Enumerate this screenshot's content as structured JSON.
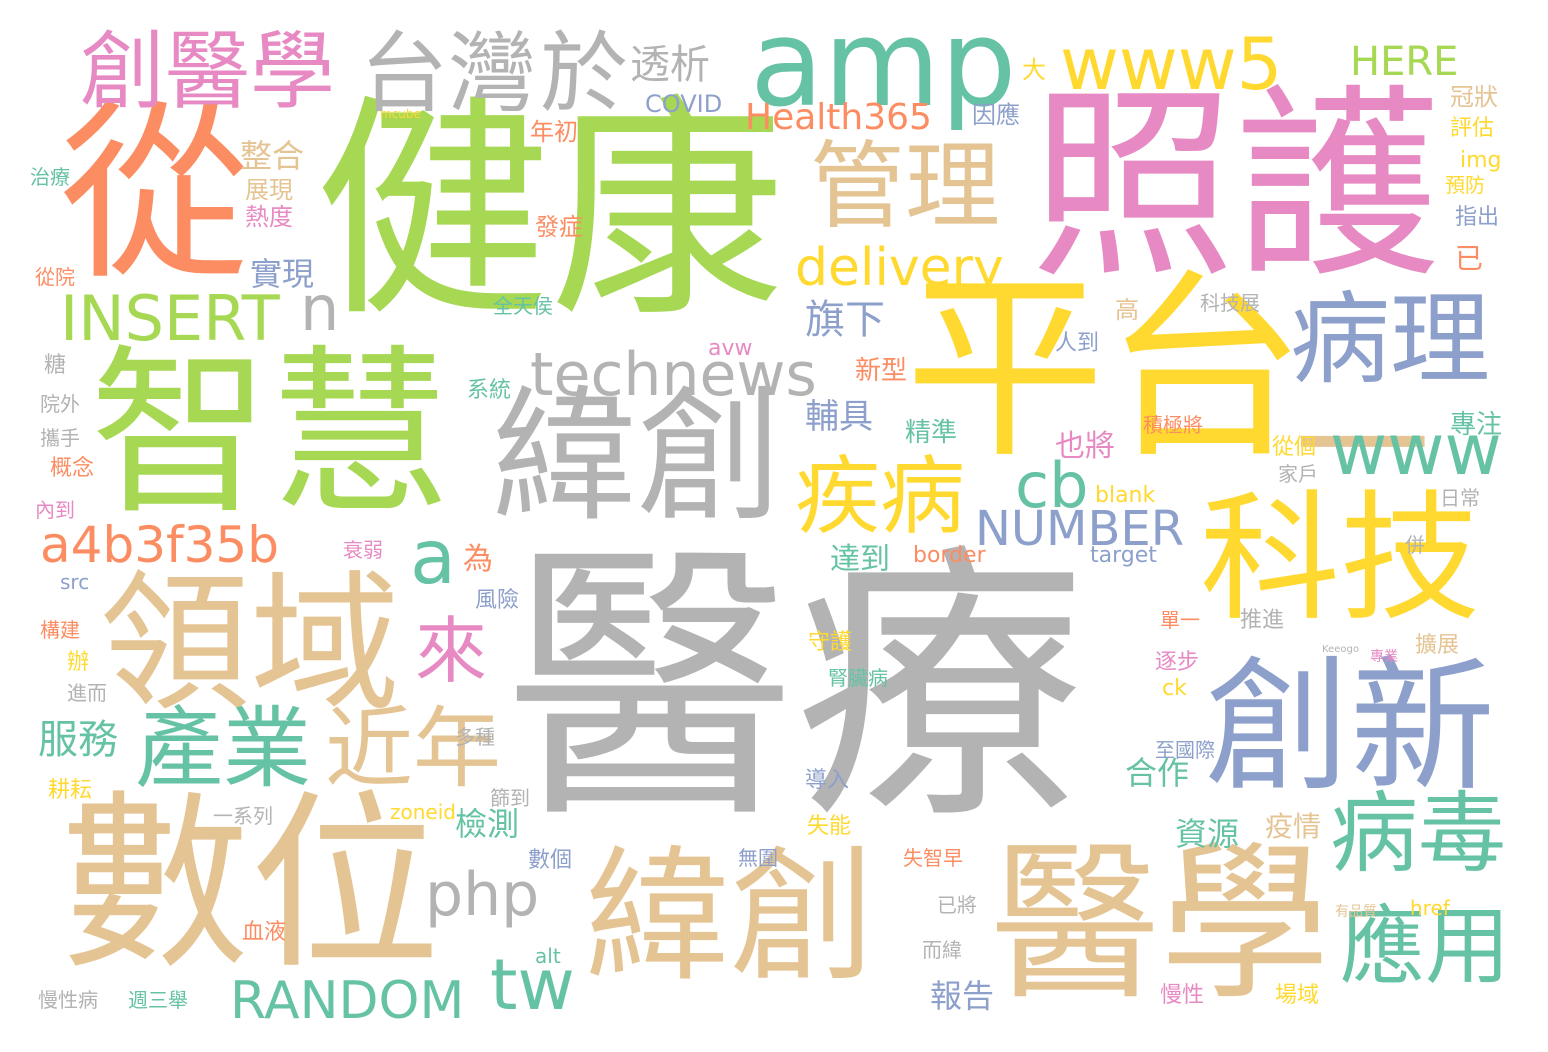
{
  "palette": {
    "gray": "#b3b3b3",
    "green": "#a6d854",
    "orange": "#fc8d62",
    "pink": "#e78ac3",
    "yellow": "#ffd92f",
    "tan": "#e5c494",
    "blue": "#8da0cb",
    "teal": "#66c2a5"
  },
  "words": [
    {
      "text": "醫療",
      "color": "gray",
      "vertical": false
    },
    {
      "text": "健康",
      "color": "green",
      "vertical": false
    },
    {
      "text": "照護",
      "color": "pink",
      "vertical": false
    },
    {
      "text": "平台",
      "color": "yellow",
      "vertical": false
    },
    {
      "text": "從",
      "color": "orange",
      "vertical": false
    },
    {
      "text": "智慧",
      "color": "green",
      "vertical": false
    },
    {
      "text": "數位",
      "color": "tan",
      "vertical": false
    },
    {
      "text": "緯創",
      "color": "gray",
      "vertical": false
    },
    {
      "text": "緯創",
      "color": "tan",
      "vertical": false
    },
    {
      "text": "醫學",
      "color": "tan",
      "vertical": false
    },
    {
      "text": "領域",
      "color": "tan",
      "vertical": false
    },
    {
      "text": "科技",
      "color": "yellow",
      "vertical": false
    },
    {
      "text": "創新",
      "color": "blue",
      "vertical": false
    },
    {
      "text": "一",
      "color": "tan",
      "vertical": false
    },
    {
      "text": "amp",
      "color": "teal",
      "vertical": false
    },
    {
      "text": "創醫學",
      "color": "pink",
      "vertical": false
    },
    {
      "text": "台灣",
      "color": "gray",
      "vertical": false
    },
    {
      "text": "於",
      "color": "gray",
      "vertical": false
    },
    {
      "text": "管理",
      "color": "tan",
      "vertical": false
    },
    {
      "text": "病理",
      "color": "blue",
      "vertical": false
    },
    {
      "text": "病毒",
      "color": "teal",
      "vertical": false
    },
    {
      "text": "疾病",
      "color": "yellow",
      "vertical": false
    },
    {
      "text": "產業",
      "color": "teal",
      "vertical": false
    },
    {
      "text": "近年",
      "color": "tan",
      "vertical": false
    },
    {
      "text": "應用",
      "color": "teal",
      "vertical": false
    },
    {
      "text": "www5",
      "color": "yellow",
      "vertical": false
    },
    {
      "text": "www",
      "color": "teal",
      "vertical": false
    },
    {
      "text": "technews",
      "color": "gray",
      "vertical": false
    },
    {
      "text": "delivery",
      "color": "yellow",
      "vertical": false
    },
    {
      "text": "INSERT",
      "color": "green",
      "vertical": false
    },
    {
      "text": "a4b3f35b",
      "color": "orange",
      "vertical": false
    },
    {
      "text": "php",
      "color": "gray",
      "vertical": false
    },
    {
      "text": "RANDOM",
      "color": "teal",
      "vertical": false
    },
    {
      "text": "NUMBER",
      "color": "blue",
      "vertical": false
    },
    {
      "text": "tw",
      "color": "teal",
      "vertical": false
    },
    {
      "text": "cb",
      "color": "teal",
      "vertical": false
    },
    {
      "text": "a",
      "color": "teal",
      "vertical": false
    },
    {
      "text": "n",
      "color": "gray",
      "vertical": false
    },
    {
      "text": "來",
      "color": "pink",
      "vertical": false
    },
    {
      "text": "Health365",
      "color": "orange",
      "vertical": false
    },
    {
      "text": "HERE",
      "color": "green",
      "vertical": false
    },
    {
      "text": "透析",
      "color": "gray",
      "vertical": false
    },
    {
      "text": "COVID",
      "color": "blue",
      "vertical": false
    },
    {
      "text": "整合",
      "color": "tan",
      "vertical": false
    },
    {
      "text": "實現",
      "color": "blue",
      "vertical": false
    },
    {
      "text": "旗下",
      "color": "blue",
      "vertical": false
    },
    {
      "text": "服務",
      "color": "teal",
      "vertical": false
    },
    {
      "text": "年初",
      "color": "orange",
      "vertical": false
    },
    {
      "text": "展現",
      "color": "tan",
      "vertical": false
    },
    {
      "text": "熱度",
      "color": "pink",
      "vertical": false
    },
    {
      "text": "發症",
      "color": "orange",
      "vertical": false
    },
    {
      "text": "新型",
      "color": "orange",
      "vertical": false
    },
    {
      "text": "輔具",
      "color": "blue",
      "vertical": false
    },
    {
      "text": "精準",
      "color": "teal",
      "vertical": false
    },
    {
      "text": "也將",
      "color": "pink",
      "vertical": false
    },
    {
      "text": "達到",
      "color": "teal",
      "vertical": false
    },
    {
      "text": "檢測",
      "color": "teal",
      "vertical": false
    },
    {
      "text": "資源",
      "color": "teal",
      "vertical": false
    },
    {
      "text": "合作",
      "color": "teal",
      "vertical": false
    },
    {
      "text": "報告",
      "color": "blue",
      "vertical": false
    },
    {
      "text": "疫情",
      "color": "tan",
      "vertical": false
    },
    {
      "text": "冠狀",
      "color": "tan",
      "vertical": false
    },
    {
      "text": "評估",
      "color": "yellow",
      "vertical": false
    },
    {
      "text": "預防",
      "color": "yellow",
      "vertical": false
    },
    {
      "text": "指出",
      "color": "blue",
      "vertical": false
    },
    {
      "text": "專注",
      "color": "teal",
      "vertical": false
    },
    {
      "text": "日常",
      "color": "gray",
      "vertical": false
    },
    {
      "text": "因應",
      "color": "blue",
      "vertical": false
    },
    {
      "text": "大",
      "color": "yellow",
      "vertical": false
    },
    {
      "text": "高",
      "color": "tan",
      "vertical": false
    },
    {
      "text": "已",
      "color": "orange",
      "vertical": false
    },
    {
      "text": "img",
      "color": "yellow",
      "vertical": false
    },
    {
      "text": "科技展",
      "color": "gray",
      "vertical": false
    },
    {
      "text": "人到",
      "color": "blue",
      "vertical": false
    },
    {
      "text": "全天侯",
      "color": "teal",
      "vertical": false
    },
    {
      "text": "系統",
      "color": "teal",
      "vertical": false
    },
    {
      "text": "avw",
      "color": "pink",
      "vertical": false
    },
    {
      "text": "積極將",
      "color": "orange",
      "vertical": false
    },
    {
      "text": "從個",
      "color": "yellow",
      "vertical": false
    },
    {
      "text": "家戶",
      "color": "gray",
      "vertical": false
    },
    {
      "text": "blank",
      "color": "yellow",
      "vertical": false
    },
    {
      "text": "target",
      "color": "blue",
      "vertical": false
    },
    {
      "text": "border",
      "color": "orange",
      "vertical": false
    },
    {
      "text": "為",
      "color": "orange",
      "vertical": false
    },
    {
      "text": "風險",
      "color": "blue",
      "vertical": false
    },
    {
      "text": "推進",
      "color": "gray",
      "vertical": false
    },
    {
      "text": "單一",
      "color": "orange",
      "vertical": false
    },
    {
      "text": "逐步",
      "color": "pink",
      "vertical": false
    },
    {
      "text": "擴展",
      "color": "tan",
      "vertical": false
    },
    {
      "text": "ck",
      "color": "yellow",
      "vertical": false
    },
    {
      "text": "守護",
      "color": "yellow",
      "vertical": false
    },
    {
      "text": "腎臟病",
      "color": "teal",
      "vertical": false
    },
    {
      "text": "至國際",
      "color": "blue",
      "vertical": false
    },
    {
      "text": "導入",
      "color": "blue",
      "vertical": false
    },
    {
      "text": "篩到",
      "color": "gray",
      "vertical": false
    },
    {
      "text": "失能",
      "color": "yellow",
      "vertical": false
    },
    {
      "text": "數個",
      "color": "blue",
      "vertical": false
    },
    {
      "text": "失智早",
      "color": "orange",
      "vertical": false
    },
    {
      "text": "無圍",
      "color": "blue",
      "vertical": false
    },
    {
      "text": "已將",
      "color": "gray",
      "vertical": false
    },
    {
      "text": "而緯",
      "color": "gray",
      "vertical": false
    },
    {
      "text": "血液",
      "color": "orange",
      "vertical": false
    },
    {
      "text": "zoneid",
      "color": "yellow",
      "vertical": false
    },
    {
      "text": "alt",
      "color": "teal",
      "vertical": false
    },
    {
      "text": "href",
      "color": "yellow",
      "vertical": false
    },
    {
      "text": "有品質",
      "color": "tan",
      "vertical": false
    },
    {
      "text": "慢性",
      "color": "pink",
      "vertical": false
    },
    {
      "text": "場域",
      "color": "yellow",
      "vertical": false
    },
    {
      "text": "週三舉",
      "color": "teal",
      "vertical": false
    },
    {
      "text": "慢性病",
      "color": "gray",
      "vertical": false
    },
    {
      "text": "一系列",
      "color": "gray",
      "vertical": false
    },
    {
      "text": "耕耘",
      "color": "yellow",
      "vertical": false
    },
    {
      "text": "辦",
      "color": "yellow",
      "vertical": false
    },
    {
      "text": "進而",
      "color": "gray",
      "vertical": false
    },
    {
      "text": "構建",
      "color": "orange",
      "vertical": false
    },
    {
      "text": "衰弱",
      "color": "pink",
      "vertical": false
    },
    {
      "text": "src",
      "color": "blue",
      "vertical": false
    },
    {
      "text": "內到",
      "color": "pink",
      "vertical": false
    },
    {
      "text": "概念",
      "color": "orange",
      "vertical": false
    },
    {
      "text": "攜手",
      "color": "gray",
      "vertical": false
    },
    {
      "text": "院外",
      "color": "gray",
      "vertical": false
    },
    {
      "text": "糖",
      "color": "gray",
      "vertical": false
    },
    {
      "text": "從院",
      "color": "orange",
      "vertical": false
    },
    {
      "text": "治療",
      "color": "teal",
      "vertical": false
    },
    {
      "text": "多種",
      "color": "gray",
      "vertical": false
    },
    {
      "text": "併",
      "color": "gray",
      "vertical": false
    },
    {
      "text": "專業",
      "color": "pink",
      "vertical": false
    },
    {
      "text": "mcube",
      "color": "yellow",
      "vertical": false
    },
    {
      "text": "Keeogo",
      "color": "gray",
      "vertical": false
    }
  ]
}
